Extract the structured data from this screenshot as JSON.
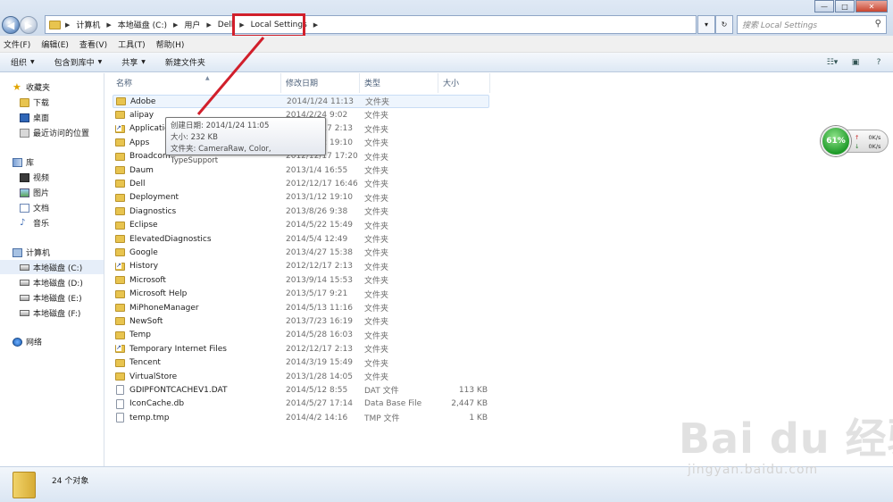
{
  "window": {
    "breadcrumbs": [
      "计算机",
      "本地磁盘 (C:)",
      "用户",
      "Dell",
      "Local Settings"
    ],
    "search_placeholder": "搜索 Local Settings",
    "minimize": "—",
    "maximize": "□",
    "close": "✕"
  },
  "menubar": [
    "文件(F)",
    "编辑(E)",
    "查看(V)",
    "工具(T)",
    "帮助(H)"
  ],
  "toolbar": {
    "organize": "组织",
    "include_library": "包含到库中",
    "share": "共享",
    "new_folder": "新建文件夹"
  },
  "sidebar": {
    "favorites": "收藏夹",
    "downloads": "下载",
    "desktop": "桌面",
    "recent": "最近访问的位置",
    "libraries": "库",
    "videos": "视频",
    "pictures": "图片",
    "documents": "文档",
    "music": "音乐",
    "computer": "计算机",
    "disk_c": "本地磁盘 (C:)",
    "disk_d": "本地磁盘 (D:)",
    "disk_e": "本地磁盘 (E:)",
    "disk_f": "本地磁盘 (F:)",
    "network": "网络"
  },
  "columns": [
    "名称",
    "修改日期",
    "类型",
    "大小"
  ],
  "files": [
    {
      "name": "Adobe",
      "date": "2014/1/24 11:13",
      "type": "文件夹",
      "size": "",
      "kind": "folder"
    },
    {
      "name": "alipay",
      "date": "2014/2/24 9:02",
      "type": "文件夹",
      "size": "",
      "kind": "folder"
    },
    {
      "name": "Application Data",
      "date": "2012/12/17 2:13",
      "type": "文件夹",
      "size": "",
      "kind": "link"
    },
    {
      "name": "Apps",
      "date": "2013/1/12 19:10",
      "type": "文件夹",
      "size": "",
      "kind": "folder"
    },
    {
      "name": "Broadcom",
      "date": "2012/12/17 17:20",
      "type": "文件夹",
      "size": "",
      "kind": "folder"
    },
    {
      "name": "Daum",
      "date": "2013/1/4 16:55",
      "type": "文件夹",
      "size": "",
      "kind": "folder"
    },
    {
      "name": "Dell",
      "date": "2012/12/17 16:46",
      "type": "文件夹",
      "size": "",
      "kind": "folder"
    },
    {
      "name": "Deployment",
      "date": "2013/1/12 19:10",
      "type": "文件夹",
      "size": "",
      "kind": "folder"
    },
    {
      "name": "Diagnostics",
      "date": "2013/8/26 9:38",
      "type": "文件夹",
      "size": "",
      "kind": "folder"
    },
    {
      "name": "Eclipse",
      "date": "2014/5/22 15:49",
      "type": "文件夹",
      "size": "",
      "kind": "folder"
    },
    {
      "name": "ElevatedDiagnostics",
      "date": "2014/5/4 12:49",
      "type": "文件夹",
      "size": "",
      "kind": "folder"
    },
    {
      "name": "Google",
      "date": "2013/4/27 15:38",
      "type": "文件夹",
      "size": "",
      "kind": "folder"
    },
    {
      "name": "History",
      "date": "2012/12/17 2:13",
      "type": "文件夹",
      "size": "",
      "kind": "link"
    },
    {
      "name": "Microsoft",
      "date": "2013/9/14 15:53",
      "type": "文件夹",
      "size": "",
      "kind": "folder"
    },
    {
      "name": "Microsoft Help",
      "date": "2013/5/17 9:21",
      "type": "文件夹",
      "size": "",
      "kind": "folder"
    },
    {
      "name": "MiPhoneManager",
      "date": "2014/5/13 11:16",
      "type": "文件夹",
      "size": "",
      "kind": "folder"
    },
    {
      "name": "NewSoft",
      "date": "2013/7/23 16:19",
      "type": "文件夹",
      "size": "",
      "kind": "folder"
    },
    {
      "name": "Temp",
      "date": "2014/5/28 16:03",
      "type": "文件夹",
      "size": "",
      "kind": "folder"
    },
    {
      "name": "Temporary Internet Files",
      "date": "2012/12/17 2:13",
      "type": "文件夹",
      "size": "",
      "kind": "link"
    },
    {
      "name": "Tencent",
      "date": "2014/3/19 15:49",
      "type": "文件夹",
      "size": "",
      "kind": "folder"
    },
    {
      "name": "VirtualStore",
      "date": "2013/1/28 14:05",
      "type": "文件夹",
      "size": "",
      "kind": "folder"
    },
    {
      "name": "GDIPFONTCACHEV1.DAT",
      "date": "2014/5/12 8:55",
      "type": "DAT 文件",
      "size": "113 KB",
      "kind": "file"
    },
    {
      "name": "IconCache.db",
      "date": "2014/5/27 17:14",
      "type": "Data Base File",
      "size": "2,447 KB",
      "kind": "file"
    },
    {
      "name": "temp.tmp",
      "date": "2014/4/2 14:16",
      "type": "TMP 文件",
      "size": "1 KB",
      "kind": "file"
    }
  ],
  "tooltip": {
    "line1": "创建日期: 2014/1/24 11:05",
    "line2": "大小: 232 KB",
    "line3": "文件夹: CameraRaw, Color, TypeSupport"
  },
  "gadget": {
    "percent": "61%",
    "up_rate": "0K/s",
    "down_rate": "0K/s",
    "up_arrow": "↑",
    "down_arrow": "↓"
  },
  "status": {
    "count": "24 个对象"
  },
  "watermark": {
    "logo": "Bai du 经验",
    "url": "jingyan.baidu.com"
  },
  "colors": {
    "annotation_red": "#d11f2b",
    "folder_yellow": "#e8c44f",
    "selection_blue": "#eef5fd"
  }
}
